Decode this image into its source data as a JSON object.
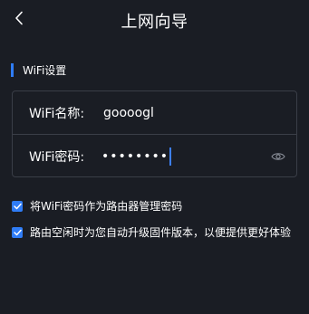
{
  "header": {
    "title": "上网向导",
    "back_icon": "chevron-left-icon"
  },
  "section": {
    "title": "WiFi设置",
    "accent_color": "#2f7cf6"
  },
  "form": {
    "ssid": {
      "label": "WiFi名称:",
      "value": "goooogl"
    },
    "password": {
      "label": "WiFi密码:",
      "masked_value": "••••••••",
      "visibility_icon": "eye-icon"
    }
  },
  "options": [
    {
      "label": "将WiFi密码作为路由器管理密码",
      "checked": true
    },
    {
      "label": "路由空闲时为您自动升级固件版本，以便提供更好体验",
      "checked": true
    }
  ],
  "colors": {
    "background": "#1a1d24",
    "accent": "#2f7cf6",
    "border": "#3a3e47",
    "text": "#ffffff"
  }
}
